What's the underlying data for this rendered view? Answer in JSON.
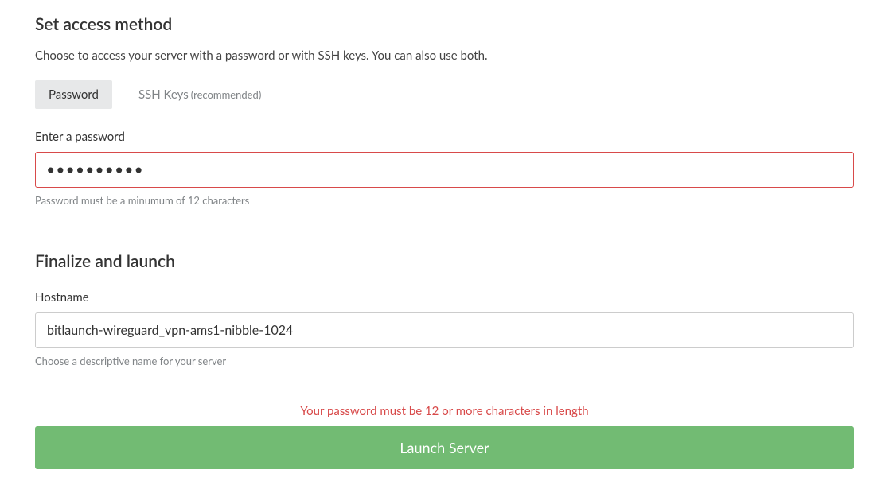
{
  "access": {
    "title": "Set access method",
    "description": "Choose to access your server with a password or with SSH keys. You can also use both.",
    "tabs": {
      "password": "Password",
      "ssh": "SSH Keys",
      "ssh_suffix": "(recommended)"
    },
    "password_label": "Enter a password",
    "password_value": "••••••••••",
    "password_help": "Password must be a minumum of 12 characters"
  },
  "finalize": {
    "title": "Finalize and launch",
    "hostname_label": "Hostname",
    "hostname_value": "bitlaunch-wireguard_vpn-ams1-nibble-1024",
    "hostname_help": "Choose a descriptive name for your server"
  },
  "error_message": "Your password must be 12 or more characters in length",
  "launch_button": "Launch Server"
}
